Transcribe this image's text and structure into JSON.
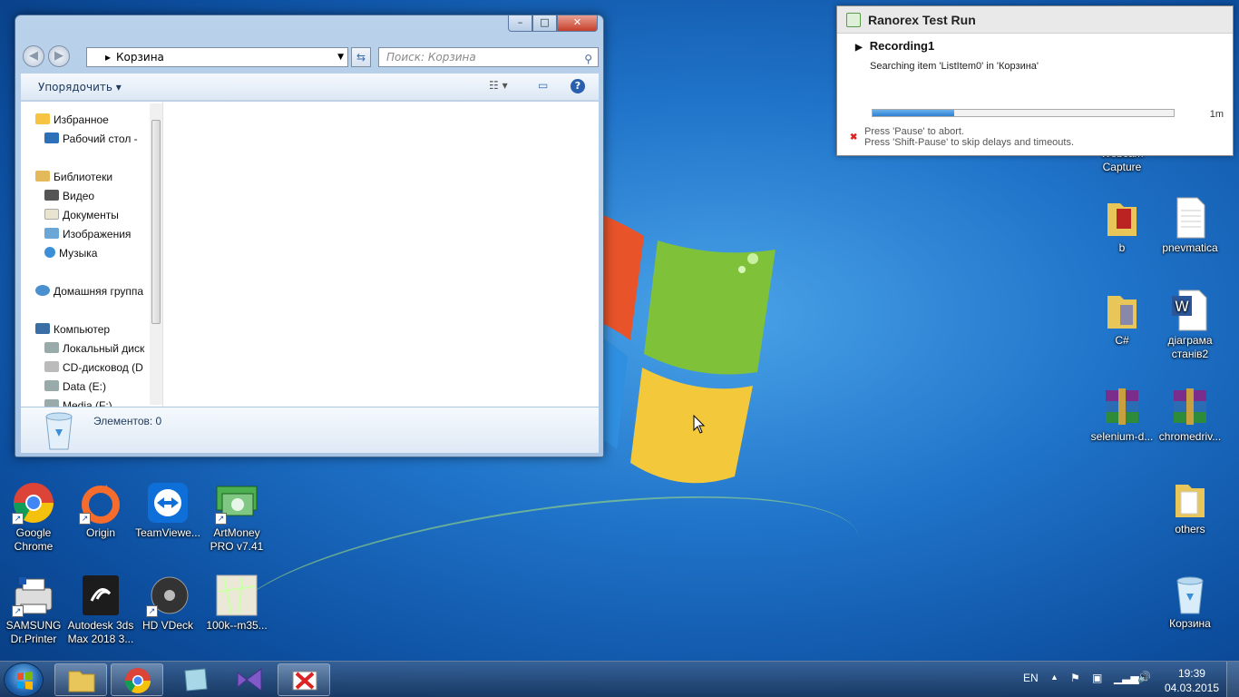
{
  "explorer": {
    "address": "Корзина",
    "search_placeholder": "Поиск: Корзина",
    "organize_label": "Упорядочить",
    "status": "Элементов: 0",
    "nav": {
      "favorites": "Избранное",
      "desktop": "Рабочий стол -",
      "libraries": "Библиотеки",
      "video": "Видео",
      "documents": "Документы",
      "images": "Изображения",
      "music": "Музыка",
      "homegroup": "Домашняя группа",
      "computer": "Компьютер",
      "local_disk": "Локальный диск",
      "cd_drive": "CD-дисковод (D",
      "data_e": "Data (E:)",
      "media_f": "Media (F:)"
    }
  },
  "ranorex": {
    "title": "Ranorex Test Run",
    "recording": "Recording1",
    "message": "Searching item 'ListItem0' in 'Корзина'",
    "eta": "1m",
    "progress": 0.27,
    "hint1": "Press 'Pause' to abort.",
    "hint2": "Press 'Shift-Pause' to skip delays and timeouts."
  },
  "desktop_icons": {
    "chrome": "Google Chrome",
    "origin": "Origin",
    "teamviewer": "TeamViewe...",
    "artmoney": "ArtMoney PRO v7.41",
    "samsung": "SAMSUNG Dr.Printer",
    "autodesk": "Autodesk 3ds Max 2018 3...",
    "hdvdeck": "HD VDeck",
    "map100k": "100k--m35...",
    "webcam": "Webcam Capture",
    "b": "b",
    "pnevmatica": "pnevmatica",
    "csharp": "C#",
    "diagram": "діаграма станів2",
    "selenium": "selenium-d...",
    "chromedriver": "chromedriv...",
    "others": "others",
    "recycle": "Корзина"
  },
  "taskbar": {
    "lang": "EN",
    "time": "19:39",
    "date": "04.03.2015"
  },
  "colors": {
    "accent": "#2f7fd1",
    "desktop_bg": "#1f73c9"
  }
}
